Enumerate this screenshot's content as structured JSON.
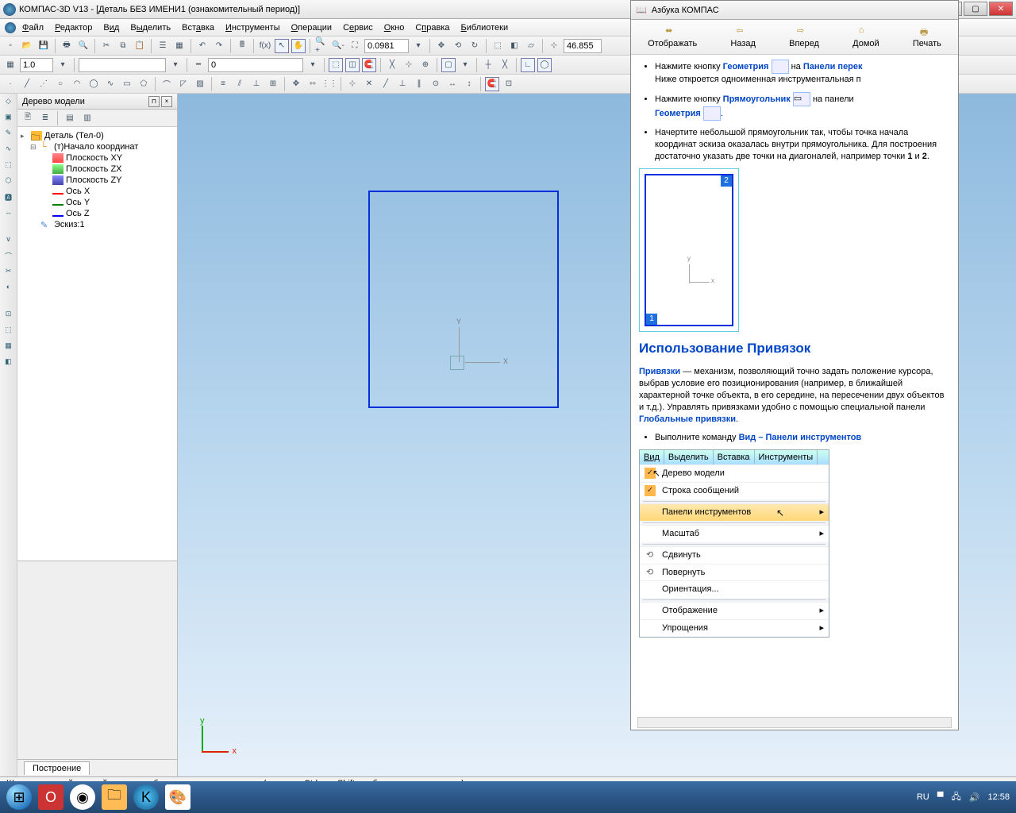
{
  "title": "КОМПАС-3D V13 - [Деталь БЕЗ ИМЕНИ1 (ознакомительный период)]",
  "menu": [
    "Файл",
    "Редактор",
    "Вид",
    "Выделить",
    "Вставка",
    "Инструменты",
    "Операции",
    "Сервис",
    "Окно",
    "Справка",
    "Библиотеки"
  ],
  "toolbar3": {
    "scale": "1.0",
    "val2": "0"
  },
  "zoom": "0.0981",
  "coord": "46.855",
  "tree": {
    "title": "Дерево модели",
    "root": "Деталь (Тел-0)",
    "origin": "(т)Начало координат",
    "pxy": "Плоскость XY",
    "pzx": "Плоскость ZX",
    "pzy": "Плоскость ZY",
    "ox": "Ось X",
    "oy": "Ось Y",
    "oz": "Ось Z",
    "sketch": "Эскиз:1"
  },
  "tab_bottom": "Построение",
  "help": {
    "title": "Азбука КОМПАС",
    "nav": {
      "show": "Отображать",
      "back": "Назад",
      "fwd": "Вперед",
      "home": "Домой",
      "print": "Печать"
    },
    "li1a": "Нажмите кнопку ",
    "li1b": "Геометрия",
    "li1c": " на ",
    "li1d": "Панели перек",
    "li1e": "Ниже откроется одноименная инструментальная п",
    "li2a": "Нажмите кнопку ",
    "li2b": "Прямоугольник",
    "li2c": " на панели ",
    "li2d": "Геометрия",
    "li3": "Начертите небольшой прямоугольник так, чтобы точка начала координат эскиза оказалась внутри прямоугольника. Для построения достаточно указать две точки на диагоналей, например точки ",
    "pt1": "1",
    "and": " и ",
    "pt2": "2",
    "h3": "Использование Привязок",
    "p1a": "Привязки",
    "p1b": " — механизм, позволяющий точно задать положение курсора, выбрав условие его позиционирования (например, в ближайшей характерной точке объекта, в его середине, на пересечении двух объектов и т.д.). Управлять привязками удобно с помощью специальной панели ",
    "p1c": "Глобальные привязки",
    "li4a": "Выполните команду ",
    "li4b": "Вид – Панели инструментов",
    "menu": {
      "tabs": [
        "Вид",
        "Выделить",
        "Вставка",
        "Инструменты"
      ],
      "m1": "Дерево модели",
      "m2": "Строка сообщений",
      "m3": "Панели инструментов",
      "m4": "Масштаб",
      "m5": "Сдвинуть",
      "m6": "Повернуть",
      "m7": "Ориентация...",
      "m8": "Отображение",
      "m9": "Упрощения"
    }
  },
  "status": "Щелкните левой кнопкой мыши на объекте для его выделения (вместе с Ctrl или Shift - добавить к выделенным)",
  "taskbar": {
    "lang": "RU",
    "time": "12:58"
  }
}
